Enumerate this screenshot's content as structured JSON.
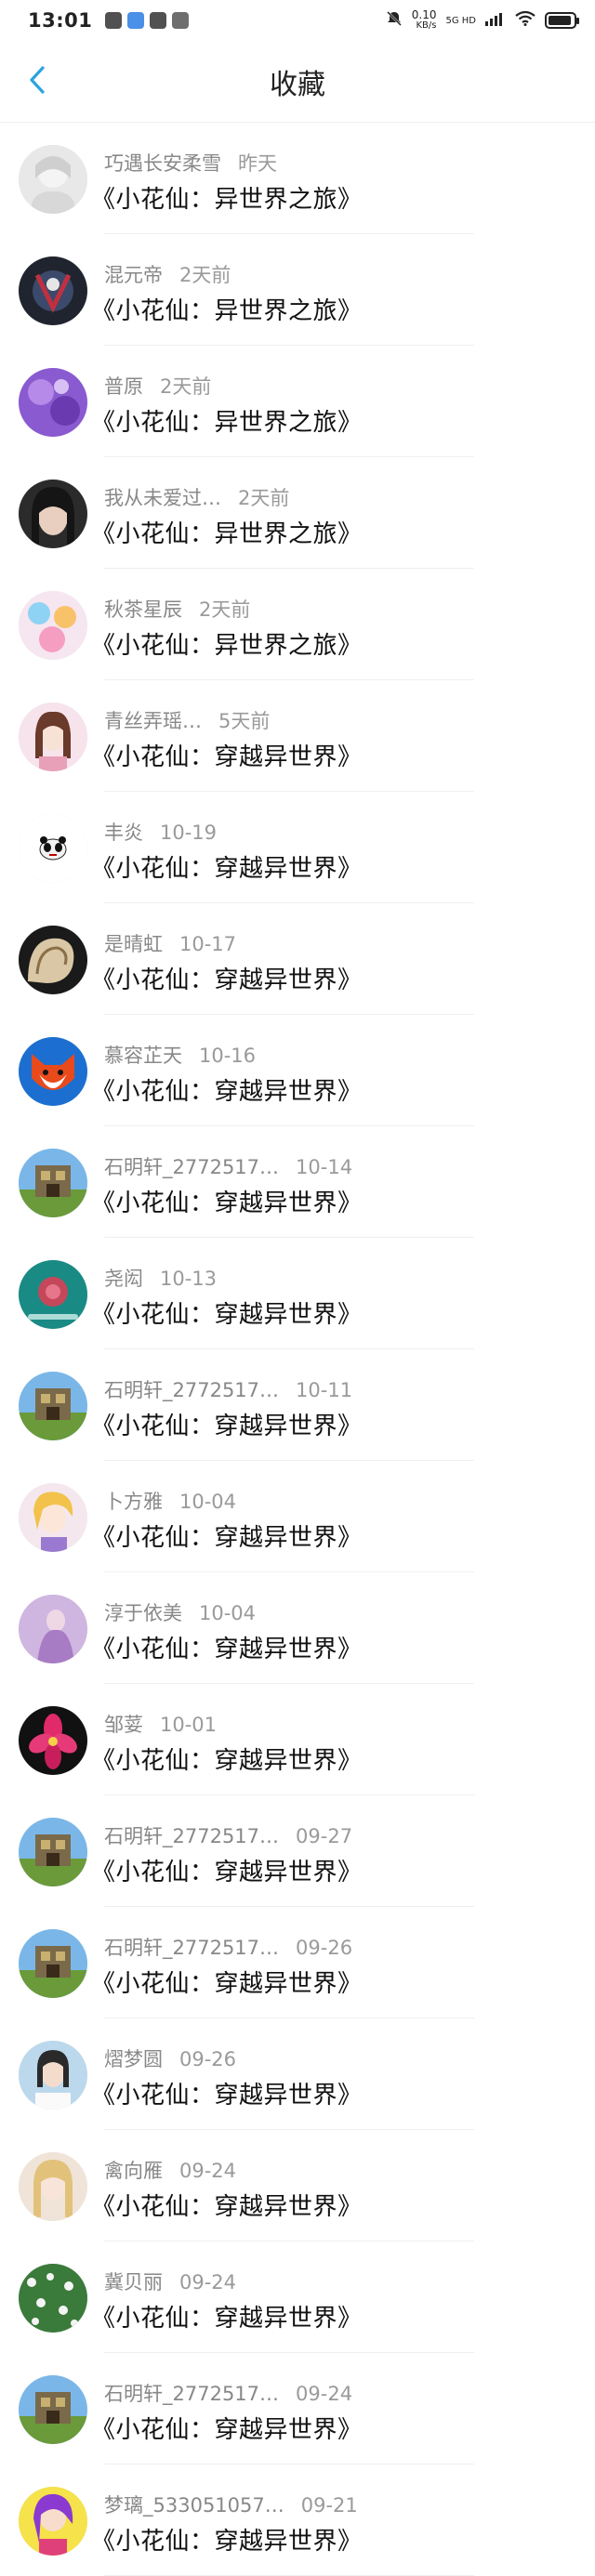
{
  "status_bar": {
    "time": "13:01",
    "net_speed_value": "0.10",
    "net_speed_unit": "KB/s",
    "network": "5G HD"
  },
  "header": {
    "title": "收藏"
  },
  "items": [
    {
      "name": "巧遇长安柔雪",
      "time": "昨天",
      "title": "《小花仙：异世界之旅》",
      "avatar": "light"
    },
    {
      "name": "混元帝",
      "time": "2天前",
      "title": "《小花仙：异世界之旅》",
      "avatar": "dark"
    },
    {
      "name": "普原",
      "time": "2天前",
      "title": "《小花仙：异世界之旅》",
      "avatar": "purple"
    },
    {
      "name": "我从未爱过…",
      "time": "2天前",
      "title": "《小花仙：异世界之旅》",
      "avatar": "girl"
    },
    {
      "name": "秋茶星辰",
      "time": "2天前",
      "title": "《小花仙：异世界之旅》",
      "avatar": "pastel"
    },
    {
      "name": "青丝弄瑶…",
      "time": "5天前",
      "title": "《小花仙：穿越异世界》",
      "avatar": "pink"
    },
    {
      "name": "丰炎",
      "time": "10-19",
      "title": "《小花仙：穿越异世界》",
      "avatar": "panda"
    },
    {
      "name": "是晴虹",
      "time": "10-17",
      "title": "《小花仙：穿越异世界》",
      "avatar": "shell"
    },
    {
      "name": "慕容芷天",
      "time": "10-16",
      "title": "《小花仙：穿越异世界》",
      "avatar": "fox"
    },
    {
      "name": "石明轩_2772517…",
      "time": "10-14",
      "title": "《小花仙：穿越异世界》",
      "avatar": "block"
    },
    {
      "name": "尧闳",
      "time": "10-13",
      "title": "《小花仙：穿越异世界》",
      "avatar": "teal"
    },
    {
      "name": "石明轩_2772517…",
      "time": "10-11",
      "title": "《小花仙：穿越异世界》",
      "avatar": "block"
    },
    {
      "name": "卜方雅",
      "time": "10-04",
      "title": "《小花仙：穿越异世界》",
      "avatar": "anime"
    },
    {
      "name": "淳于依美",
      "time": "10-04",
      "title": "《小花仙：穿越异世界》",
      "avatar": "lavender"
    },
    {
      "name": "邹荽",
      "time": "10-01",
      "title": "《小花仙：穿越异世界》",
      "avatar": "flower"
    },
    {
      "name": "石明轩_2772517…",
      "time": "09-27",
      "title": "《小花仙：穿越异世界》",
      "avatar": "block"
    },
    {
      "name": "石明轩_2772517…",
      "time": "09-26",
      "title": "《小花仙：穿越异世界》",
      "avatar": "block"
    },
    {
      "name": "熠梦圆",
      "time": "09-26",
      "title": "《小花仙：穿越异世界》",
      "avatar": "portrait"
    },
    {
      "name": "禽向雁",
      "time": "09-24",
      "title": "《小花仙：穿越异世界》",
      "avatar": "blonde"
    },
    {
      "name": "冀贝丽",
      "time": "09-24",
      "title": "《小花仙：穿越异世界》",
      "avatar": "field"
    },
    {
      "name": "石明轩_2772517…",
      "time": "09-24",
      "title": "《小花仙：穿越异世界》",
      "avatar": "block"
    },
    {
      "name": "梦璃_533051057…",
      "time": "09-21",
      "title": "《小花仙：穿越异世界》",
      "avatar": "colorful"
    }
  ]
}
